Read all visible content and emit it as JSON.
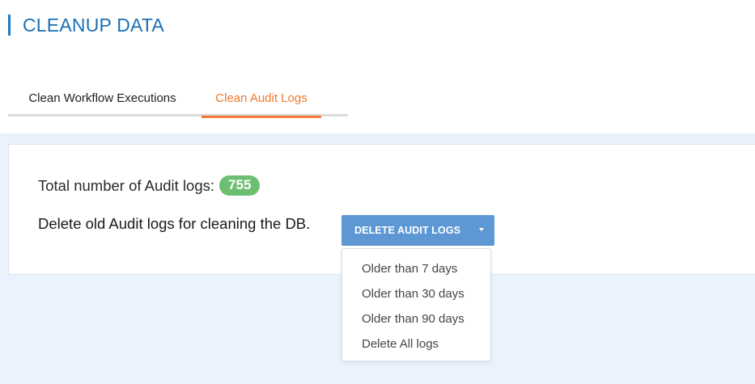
{
  "header": {
    "title": "CLEANUP DATA"
  },
  "tabs": [
    {
      "label": "Clean Workflow Executions",
      "active": false
    },
    {
      "label": "Clean Audit Logs",
      "active": true
    }
  ],
  "audit": {
    "total_label": "Total number of Audit logs:",
    "total_count": "755",
    "delete_text": "Delete old Audit logs for cleaning the DB.",
    "delete_button_label": "DELETE AUDIT LOGS"
  },
  "dropdown": {
    "items": [
      "Older than 7 days",
      "Older than 30 days",
      "Older than 90 days",
      "Delete All logs"
    ]
  },
  "colors": {
    "title": "#1c6fb5",
    "active_tab": "#f0782f",
    "badge": "#6cbf72",
    "button": "#5d98d4",
    "content_background": "#eaf3fd"
  }
}
